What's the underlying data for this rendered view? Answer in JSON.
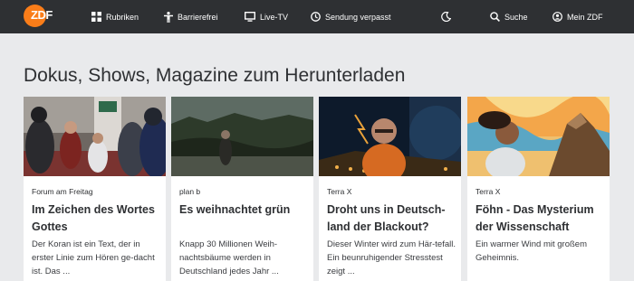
{
  "header": {
    "logo_text": "ZDF",
    "nav": [
      {
        "label": "Rubriken",
        "icon": "grid-icon"
      },
      {
        "label": "Barrierefrei",
        "icon": "accessibility-icon"
      },
      {
        "label": "Live-TV",
        "icon": "tv-icon"
      },
      {
        "label": "Sendung verpasst",
        "icon": "clock-icon"
      },
      {
        "label": "Suche",
        "icon": "search-icon"
      },
      {
        "label": "Mein ZDF",
        "icon": "user-icon"
      }
    ],
    "theme_toggle_icon": "moon-icon",
    "colors": {
      "bar": "#2e3033",
      "brand": "#fa7d19"
    }
  },
  "section_title": "Dokus, Shows, Magazine zum Herunterladen",
  "cards": [
    {
      "kicker": "Forum am Freitag",
      "title": "Im Zeichen des Wortes Gottes",
      "teaser": "Der Koran ist ein Text, der in erster Linie zum Hören ge-dacht ist. Das ..."
    },
    {
      "kicker": "plan b",
      "title": "Es weihnachtet grün",
      "teaser": "Knapp 30 Millionen Weih-nachtsbäume werden in Deutschland jedes Jahr ..."
    },
    {
      "kicker": "Terra X",
      "title": "Droht uns in Deutsch-land der Blackout?",
      "teaser": "Dieser Winter wird zum Här-tefall. Ein beunruhigender Stresstest zeigt ..."
    },
    {
      "kicker": "Terra X",
      "title": "Föhn - Das Mysterium der Wissenschaft",
      "teaser": "Ein warmer Wind mit großem Geheimnis."
    }
  ]
}
